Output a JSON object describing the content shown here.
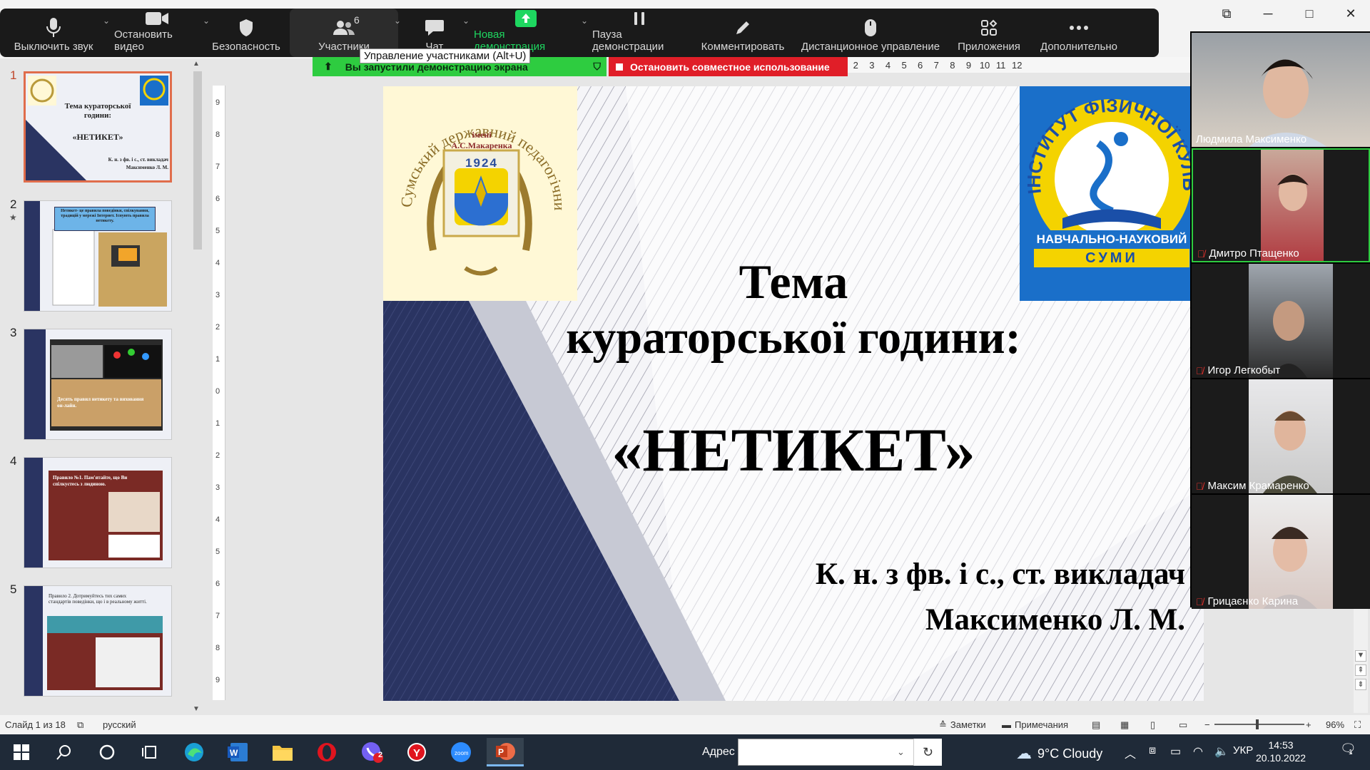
{
  "window": {
    "restore_icon": "restore-icon",
    "minimize": "─",
    "maximize": "□",
    "close": "✕"
  },
  "toolbar": {
    "mute": "Выключить звук",
    "video": "Остановить видео",
    "security": "Безопасность",
    "participants": "Участники",
    "participants_count": "6",
    "chat": "Чат",
    "new_share": "Новая демонстрация",
    "pause_share": "Пауза демонстрации",
    "annotate": "Комментировать",
    "remote_control": "Дистанционное управление",
    "apps": "Приложения",
    "more": "Дополнительно"
  },
  "tooltip": "Управление участниками (Alt+U)",
  "share_banner": {
    "text": "Вы запустили демонстрацию экрана",
    "stop": "Остановить совместное использование"
  },
  "hruler": [
    "2",
    "3",
    "4",
    "5",
    "6",
    "7",
    "8",
    "9",
    "10",
    "11",
    "12"
  ],
  "vruler": [
    "9",
    "8",
    "7",
    "6",
    "5",
    "4",
    "3",
    "2",
    "1",
    "0",
    "1",
    "2",
    "3",
    "4",
    "5",
    "6",
    "7",
    "8",
    "9"
  ],
  "thumbnails": [
    {
      "num": "1",
      "title": "Тема кураторської години:",
      "sub": "«НЕТИКЕТ»",
      "author": "К. н. з фв. і с., ст. викладач Максименко Л. М."
    },
    {
      "num": "2",
      "star": "★",
      "text": "Нетикет- це правила поведінки, спілкування, традицій у мережі Інтернет. Існують правила нетикету."
    },
    {
      "num": "3",
      "text": "Десять правил нетикету та виховання он-лайн."
    },
    {
      "num": "4",
      "text": "Правило №1. Пам'ятайте, що Ви спілкуєтесь з людиною."
    },
    {
      "num": "5",
      "text": "Правило 2. Дотримуйтесь тих самих стандартів поведінки, що і в реальному житті."
    }
  ],
  "slide": {
    "left_logo_arc": "Сумський державний педагогічний університет",
    "left_logo_name": "імені А.С.Макаренка",
    "left_logo_year": "1924",
    "right_logo_arc": "ІНСТИТУТ ФІЗИЧНОЇ КУЛЬТУРИ",
    "right_logo_band": "НАВЧАЛЬНО-НАУКОВИЙ",
    "right_logo_city": "СУМИ",
    "title1": "Тема",
    "title2": "кураторської години:",
    "title3": "«НЕТИКЕТ»",
    "author1": "К. н. з фв. і с., ст. викладач",
    "author2": "Максименко Л. М."
  },
  "participants": [
    {
      "name": "Людмила Максименко",
      "muted": false
    },
    {
      "name": "Дмитро Птащенко",
      "muted": true
    },
    {
      "name": "Игор Легкобыт",
      "muted": true
    },
    {
      "name": "Максим Крамаренко",
      "muted": true
    },
    {
      "name": "Грицаєнко Карина",
      "muted": true
    }
  ],
  "status": {
    "slide": "Слайд 1 из 18",
    "lang": "русский",
    "notes": "Заметки",
    "comments": "Примечания",
    "zoom": "96%"
  },
  "taskbar": {
    "address_label": "Адрес",
    "weather": "9°C  Cloudy",
    "lang": "УКР",
    "time": "14:53",
    "date": "20.10.2022",
    "notif_count": "1",
    "viber_badge": "2"
  },
  "colors": {
    "zoom_bg": "#1a1a1a",
    "share_green": "#2ecc40",
    "share_red": "#e01e28",
    "thumb_select": "#e06d4b",
    "slide_navy": "#2a3462",
    "taskbar": "#1f2a38"
  }
}
